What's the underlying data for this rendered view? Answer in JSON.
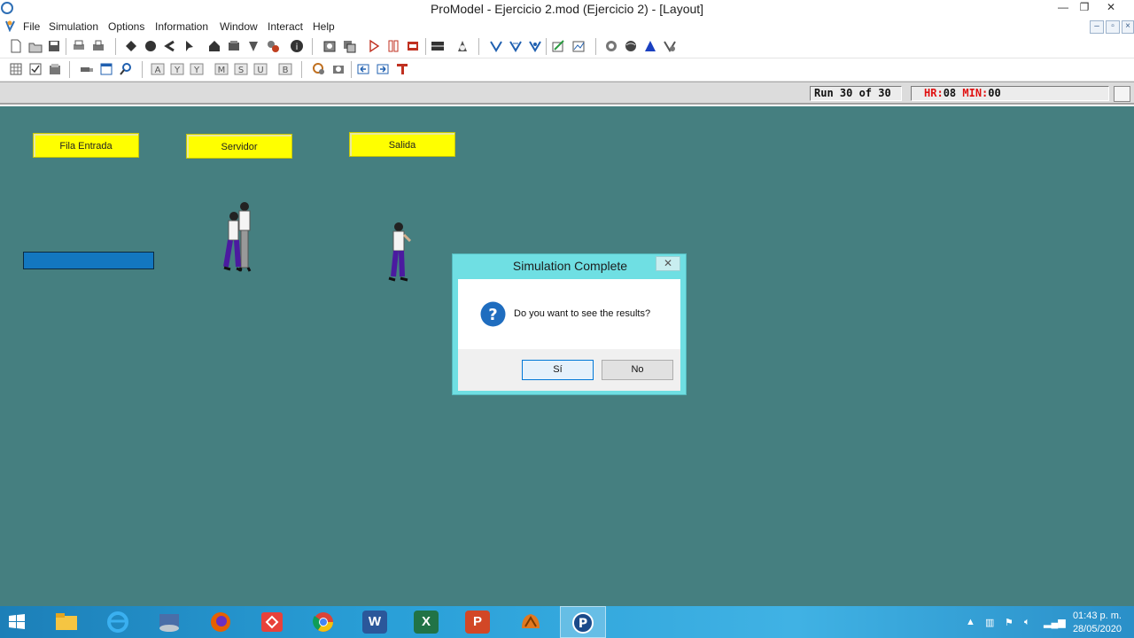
{
  "window": {
    "title": "ProModel - Ejercicio 2.mod (Ejercicio 2) - [Layout]",
    "minimize": "—",
    "restore": "❐",
    "close": "✕"
  },
  "menu": {
    "items": [
      "File",
      "Simulation",
      "Options",
      "Information",
      "Window",
      "Interact",
      "Help"
    ]
  },
  "status": {
    "run": "Run 30 of 30",
    "hr_label": "HR:",
    "hr_value": "08",
    "min_label": "MIN:",
    "min_value": "00"
  },
  "layout": {
    "locations": [
      "Fila Entrada",
      "Servidor",
      "Salida"
    ]
  },
  "dialog": {
    "title": "Simulation Complete",
    "close": "✕",
    "message": "Do you want to see the results?",
    "yes": "Sí",
    "no": "No",
    "icon": "question-icon"
  },
  "taskbar": {
    "apps": [
      "windows-start",
      "file-explorer",
      "internet-explorer",
      "app-remote",
      "firefox",
      "git-app",
      "chrome",
      "word",
      "excel",
      "powerpoint",
      "promodel-run",
      "promodel"
    ],
    "word_letter": "W",
    "excel_letter": "X",
    "powerpoint_letter": "P",
    "time": "01:43 p. m.",
    "date": "28/05/2020"
  }
}
